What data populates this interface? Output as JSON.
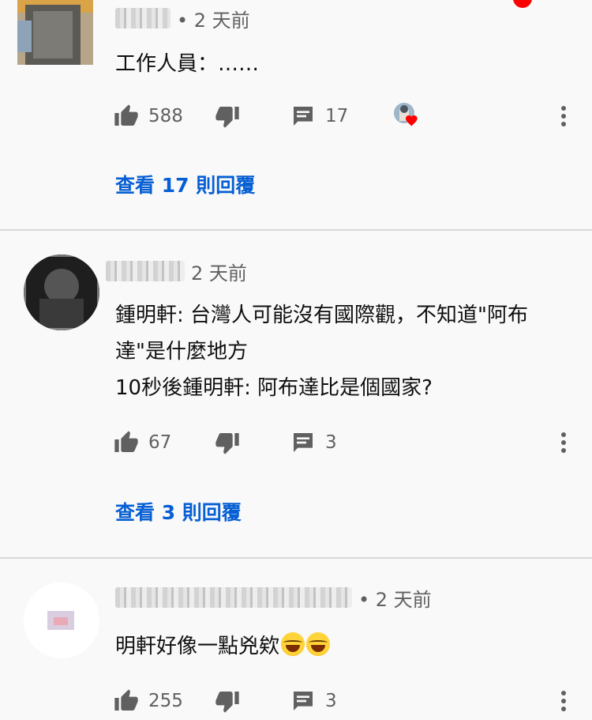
{
  "comments": [
    {
      "time": "• 2 天前",
      "lines": [
        "工作人員：……"
      ],
      "likes": "588",
      "reply_count": "17",
      "view_replies": "查看 17 則回覆"
    },
    {
      "time": "2 天前",
      "lines": [
        "鍾明軒: 台灣人可能沒有國際觀，不知道\"阿布",
        "達\"是什麼地方",
        "10秒後鍾明軒: 阿布達比是個國家?"
      ],
      "likes": "67",
      "reply_count": "3",
      "view_replies": "查看 3 則回覆"
    },
    {
      "time": "• 2 天前",
      "lines": [
        "明軒好像一點兇欸"
      ],
      "emoji": [
        "face-with-tears-of-joy",
        "face-with-tears-of-joy"
      ],
      "likes": "255",
      "reply_count": "3"
    }
  ],
  "icons": {
    "like": "thumbs-up-icon",
    "dislike": "thumbs-down-icon",
    "reply": "comment-icon",
    "more": "more-vert-icon",
    "creator_heart": "creator-heart-icon"
  },
  "colors": {
    "link": "#065fd4",
    "icon": "#606060",
    "background": "#f9f9f9",
    "heart": "#ff0000"
  }
}
